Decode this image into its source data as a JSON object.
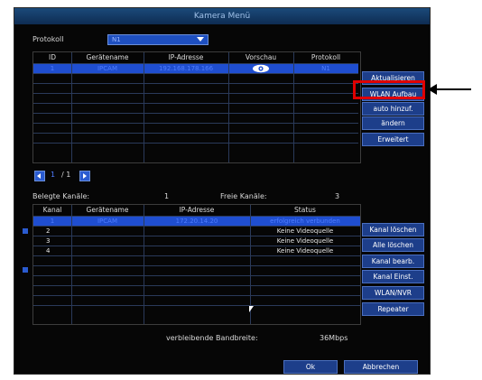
{
  "window": {
    "title": "Kamera Menü"
  },
  "protocol": {
    "label": "Protokoll",
    "value": "N1"
  },
  "search_table": {
    "columns": [
      "ID",
      "Gerätename",
      "IP-Adresse",
      "Vorschau",
      "Protokoll"
    ],
    "rows": [
      {
        "id": "1",
        "name": "IPCAM",
        "ip": "192.168.178.166",
        "preview": "eye-icon",
        "protocol": "N1"
      }
    ],
    "empty_rows": 8
  },
  "side_buttons_top": [
    "Aktualisieren",
    "WLAN Aufbau",
    "auto hinzuf.",
    "ändern",
    "Erweitert"
  ],
  "pager": {
    "current": "1",
    "total": "/ 1"
  },
  "channels": {
    "used_label": "Belegte Kanäle:",
    "used_value": "1",
    "free_label": "Freie Kanäle:",
    "free_value": "3"
  },
  "channel_table": {
    "columns": [
      "Kanal",
      "Gerätename",
      "IP-Adresse",
      "Status"
    ],
    "rows": [
      {
        "ch": "1",
        "name": "IPCAM",
        "ip": "172.20.14.20",
        "status": "erfolgreich verbunden",
        "selected": true
      },
      {
        "ch": "2",
        "name": "",
        "ip": "",
        "status": "Keine Videoquelle",
        "selected": false
      },
      {
        "ch": "3",
        "name": "",
        "ip": "",
        "status": "Keine Videoquelle",
        "selected": false
      },
      {
        "ch": "4",
        "name": "",
        "ip": "",
        "status": "Keine Videoquelle",
        "selected": false
      }
    ],
    "empty_rows": 6
  },
  "side_buttons_bottom": [
    "Kanal löschen",
    "Alle löschen",
    "Kanal bearb.",
    "Kanal Einst.",
    "WLAN/NVR",
    "Repeater"
  ],
  "bandwidth": {
    "label": "verbleibende Bandbreite:",
    "value": "36Mbps"
  },
  "footer": {
    "ok": "Ok",
    "cancel": "Abbrechen"
  },
  "colors": {
    "highlight": "#e00000",
    "selection": "#1f4ed0",
    "button": "#1d3e8a"
  }
}
